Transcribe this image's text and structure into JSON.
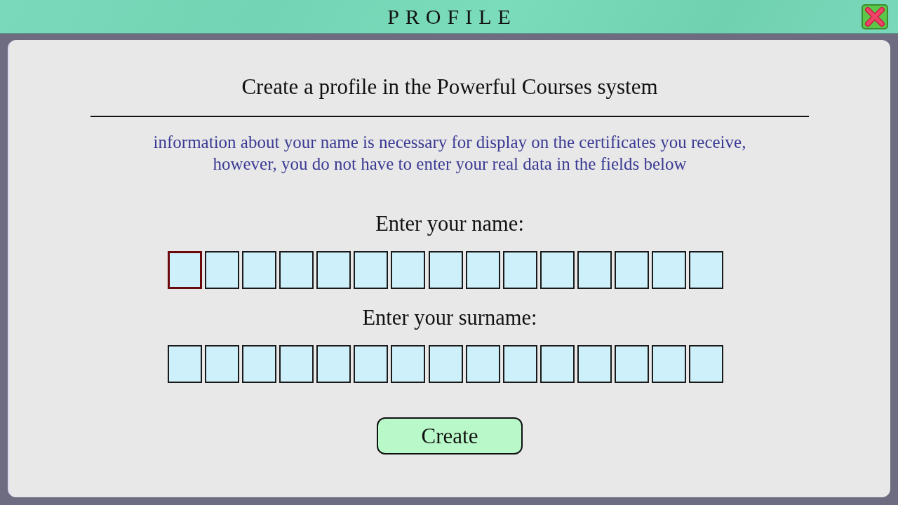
{
  "window": {
    "title": "PROFILE"
  },
  "form": {
    "heading": "Create a profile in the Powerful Courses system",
    "info": "information about your name is necessary for display on the certificates you receive, however, you do not have to enter your real data in the fields below"
  },
  "fields": [
    {
      "label": "Enter your name:",
      "cells": [
        {
          "focused": true
        },
        {
          "focused": false
        },
        {
          "focused": false
        },
        {
          "focused": false
        },
        {
          "focused": false
        },
        {
          "focused": false
        },
        {
          "focused": false
        },
        {
          "focused": false
        },
        {
          "focused": false
        },
        {
          "focused": false
        },
        {
          "focused": false
        },
        {
          "focused": false
        },
        {
          "focused": false
        },
        {
          "focused": false
        },
        {
          "focused": false
        }
      ]
    },
    {
      "label": "Enter your surname:",
      "cells": [
        {
          "focused": false
        },
        {
          "focused": false
        },
        {
          "focused": false
        },
        {
          "focused": false
        },
        {
          "focused": false
        },
        {
          "focused": false
        },
        {
          "focused": false
        },
        {
          "focused": false
        },
        {
          "focused": false
        },
        {
          "focused": false
        },
        {
          "focused": false
        },
        {
          "focused": false
        },
        {
          "focused": false
        },
        {
          "focused": false
        },
        {
          "focused": false
        }
      ]
    }
  ],
  "create_button": {
    "label": "Create"
  }
}
